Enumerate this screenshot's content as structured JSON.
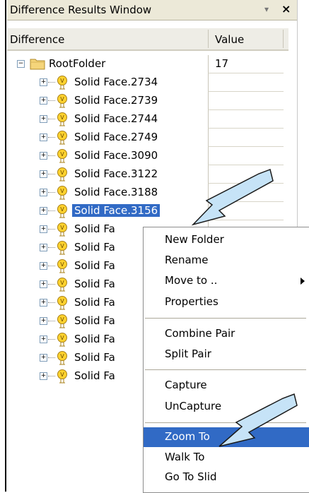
{
  "window": {
    "title": "Difference Results Window",
    "pin_glyph": "▾",
    "close_glyph": "×"
  },
  "columns": {
    "difference": "Difference",
    "value": "Value"
  },
  "root": {
    "label": "RootFolder",
    "value": "17",
    "expander": "⊟"
  },
  "items": [
    {
      "label": "Solid Face.2734"
    },
    {
      "label": "Solid Face.2739"
    },
    {
      "label": "Solid Face.2744"
    },
    {
      "label": "Solid Face.2749"
    },
    {
      "label": "Solid Face.3090"
    },
    {
      "label": "Solid Face.3122"
    },
    {
      "label": "Solid Face.3188"
    },
    {
      "label": "Solid Face.3156"
    },
    {
      "label": "Solid Fa"
    },
    {
      "label": "Solid Fa"
    },
    {
      "label": "Solid Fa"
    },
    {
      "label": "Solid Fa"
    },
    {
      "label": "Solid Fa"
    },
    {
      "label": "Solid Fa"
    },
    {
      "label": "Solid Fa"
    },
    {
      "label": "Solid Fa"
    },
    {
      "label": "Solid Fa"
    }
  ],
  "selected_index": 7,
  "context_menu": {
    "items": [
      {
        "label": "New Folder"
      },
      {
        "label": "Rename"
      },
      {
        "label": "Move to .."
      },
      {
        "label": "Properties"
      },
      {
        "label": "Combine Pair"
      },
      {
        "label": "Split Pair"
      },
      {
        "label": "Capture"
      },
      {
        "label": "UnCapture"
      },
      {
        "label": "Zoom To"
      },
      {
        "label": "Walk To"
      },
      {
        "label": "Go To Slid"
      }
    ],
    "highlighted": "Zoom To"
  },
  "colors": {
    "selection": "#316ac5",
    "callout_fill": "#c6e3f7",
    "callout_stroke": "#1a1a1a"
  }
}
